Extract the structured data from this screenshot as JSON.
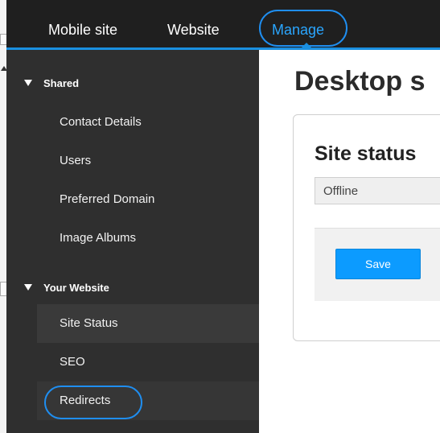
{
  "topnav": {
    "mobile_site": "Mobile site",
    "website": "Website",
    "manage": "Manage"
  },
  "sidebar": {
    "sections": [
      {
        "label": "Shared",
        "items": [
          "Contact Details",
          "Users",
          "Preferred Domain",
          "Image Albums"
        ]
      },
      {
        "label": "Your Website",
        "items": [
          "Site Status",
          "SEO",
          "Redirects"
        ]
      }
    ]
  },
  "main": {
    "page_title": "Desktop s",
    "section_title": "Site status",
    "status_value": "Offline",
    "save_label": "Save"
  },
  "colors": {
    "accent": "#1a8fe0",
    "button": "#0c9bff",
    "highlight_circle": "#1f8ef0"
  }
}
